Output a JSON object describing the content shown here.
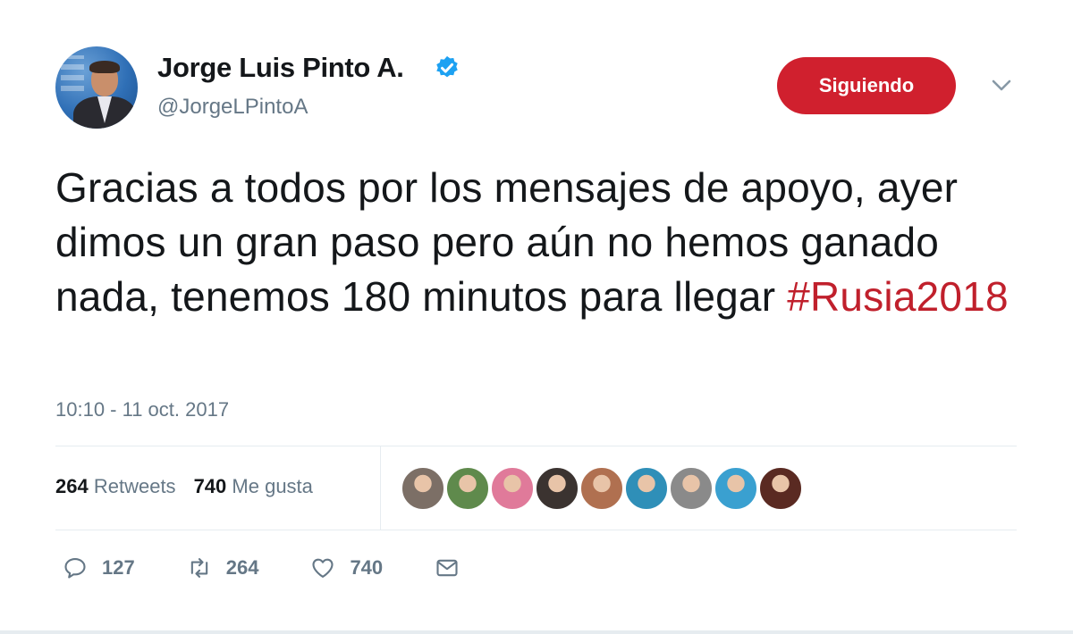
{
  "author": {
    "name": "Jorge Luis Pinto A.",
    "handle": "@JorgeLPintoA",
    "verified": true
  },
  "follow_button": {
    "label": "Siguiendo",
    "color": "#d0202e"
  },
  "tweet": {
    "text": "Gracias a todos por los mensajes de apoyo, ayer dimos un gran paso pero aún no hemos ganado nada, tenemos 180 minutos para llegar ",
    "hashtag": "#Rusia2018",
    "hashtag_color": "#c0202c",
    "timestamp": "10:10 - 11 oct. 2017"
  },
  "stats": {
    "retweets_count": "264",
    "retweets_label": "Retweets",
    "likes_count": "740",
    "likes_label": "Me gusta"
  },
  "liker_avatars": [
    "#7c6f66",
    "#5f8a4c",
    "#e07a9a",
    "#3b3330",
    "#b07050",
    "#2f8fb8",
    "#8a8a8a",
    "#3aa0d0",
    "#5a2a22"
  ],
  "actions": {
    "reply": {
      "icon": "reply-icon",
      "count": "127"
    },
    "retweet": {
      "icon": "retweet-icon",
      "count": "264"
    },
    "like": {
      "icon": "heart-icon",
      "count": "740"
    },
    "message": {
      "icon": "envelope-icon"
    }
  }
}
